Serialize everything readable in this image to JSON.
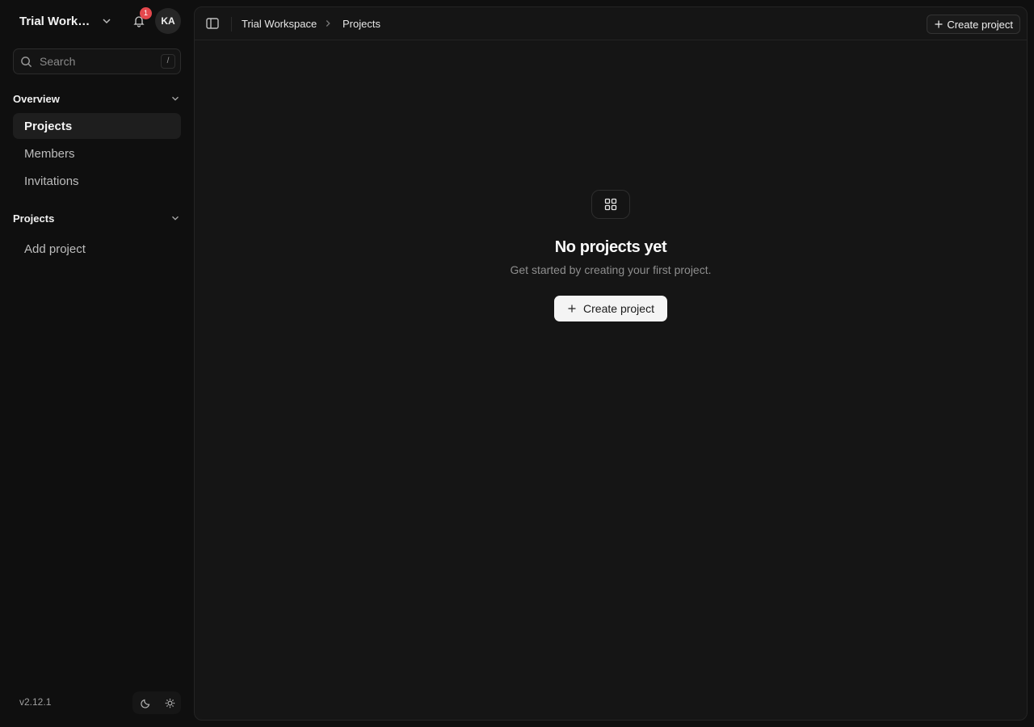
{
  "workspace": {
    "name": "Trial Works...",
    "notification_count": "1",
    "avatar_initials": "KA"
  },
  "search": {
    "placeholder": "Search",
    "shortcut": "/"
  },
  "sidebar": {
    "sections": [
      {
        "title": "Overview",
        "items": [
          "Projects",
          "Members",
          "Invitations"
        ]
      },
      {
        "title": "Projects",
        "items": [
          "Add project"
        ]
      }
    ],
    "version": "v2.12.1"
  },
  "header": {
    "breadcrumb": [
      "Trial Workspace",
      "Projects"
    ],
    "create_label": "Create project"
  },
  "empty_state": {
    "title": "No projects yet",
    "subtitle": "Get started by creating your first project.",
    "button_label": "Create project"
  }
}
